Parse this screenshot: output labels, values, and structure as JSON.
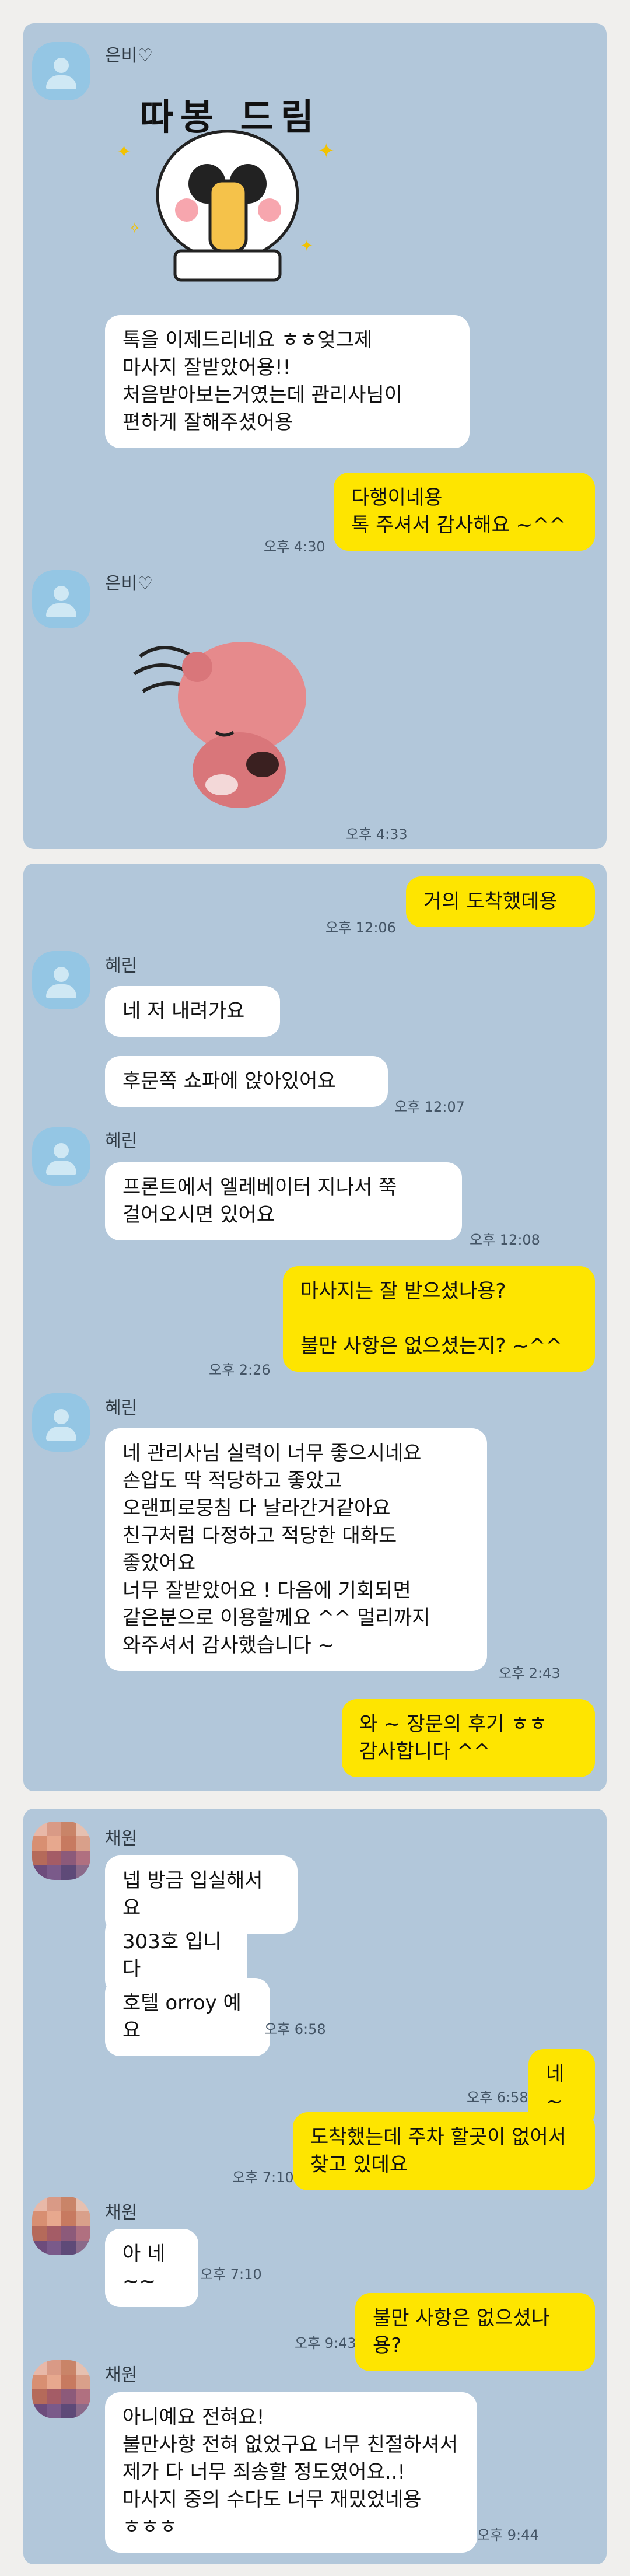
{
  "panels": [
    {
      "sender_1": "은비♡",
      "sticker_1_text": "따봉 드림",
      "bubble_1": "톡을 이제드리네요 ㅎㅎ엊그제\n마사지 잘받았어용!!\n처음받아보는거였는데 관리사님이\n편하게 잘해주셨어용",
      "bubble_2": "다행이네용\n톡 주셔서 감사해요 ~^^",
      "time_2": "오후 4:30",
      "sender_2": "은비♡",
      "time_3": "오후 4:33"
    },
    {
      "bubble_1": "거의 도착했데용",
      "time_1": "오후 12:06",
      "sender_1": "혜린",
      "bubble_2": "네 저 내려가요",
      "bubble_3": "후문쪽 쇼파에 앉아있어요",
      "time_3": "오후 12:07",
      "sender_2": "혜린",
      "bubble_4": "프론트에서 엘레베이터 지나서 쭉\n걸어오시면 있어요",
      "time_4": "오후 12:08",
      "bubble_5": "마사지는 잘 받으셨나용?\n\n불만 사항은 없으셨는지? ~^^",
      "time_5": "오후 2:26",
      "sender_3": "혜린",
      "bubble_6": "네 관리사님 실력이 너무 좋으시네요\n손압도 딱 적당하고 좋았고\n오랜피로뭉침 다 날라간거같아요\n친구처럼 다정하고 적당한 대화도\n좋았어요\n너무 잘받았어요 ! 다음에 기회되면\n같은분으로 이용할께요 ^^ 멀리까지\n와주셔서 감사했습니다 ~",
      "time_6": "오후 2:43",
      "bubble_7": "와 ~ 장문의 후기 ㅎㅎ\n감사합니다 ^^"
    },
    {
      "sender_1": "채원",
      "bubble_1": "넵 방금 입실해서요",
      "bubble_2": "303호 입니다",
      "bubble_3": "호텔 orroy 예요",
      "time_3": "오후 6:58",
      "bubble_4": "네 ~",
      "time_4": "오후 6:58",
      "bubble_5": "도착했는데  주차 할곳이 없어서\n찾고 있데요",
      "time_5": "오후 7:10",
      "sender_2": "채원",
      "bubble_6": "아 네~~",
      "time_6": "오후 7:10",
      "bubble_7": "불만 사항은 없으셨나용?",
      "time_7": "오후 9:43",
      "sender_3": "채원",
      "bubble_8": "아니예요 전혀요!\n불만사항 전혀 없었구요 너무 친절하셔서\n제가 다 너무 죄송할 정도였어요..!\n마사지 중의 수다도 너무 재밌었네용\nㅎㅎㅎ",
      "time_8": "오후 9:44"
    }
  ],
  "colors": {
    "chat_background": "#b2c7da",
    "incoming_bubble": "#ffffff",
    "outgoing_bubble": "#fee500",
    "page_background": "#f0efed"
  }
}
